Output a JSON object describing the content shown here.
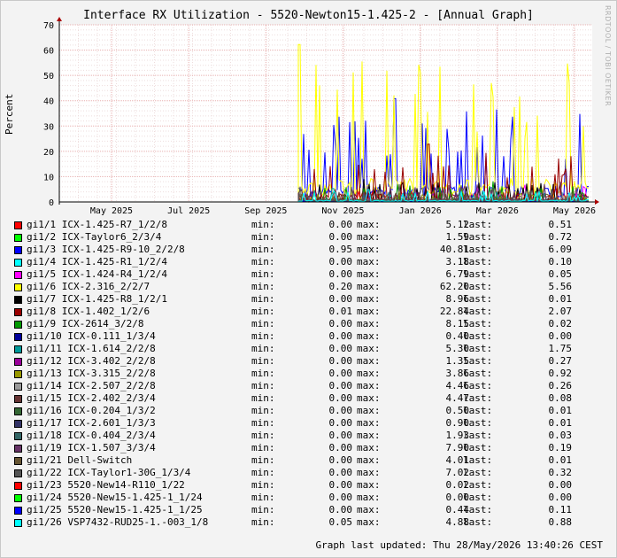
{
  "title": "Interface RX Utilization - 5520-Newton15-1.425-2 - [Annual Graph]",
  "watermark": "RRDTOOL / TOBI OETIKER",
  "updated": "Graph last updated: Thu 28/May/2026 13:40:26 CEST",
  "labels": {
    "min": "min:",
    "max": "max:",
    "last": "last:"
  },
  "colors": {
    "background": "#f3f3f3",
    "canvas": "#ffffff",
    "grid": "#e8b0b0",
    "axis": "#000000",
    "arrow": "#aa0000"
  },
  "chart_data": {
    "type": "line",
    "ylabel": "Percent",
    "ylim": [
      0,
      70
    ],
    "yticks": [
      0,
      10,
      20,
      30,
      40,
      50,
      60,
      70
    ],
    "xticks": [
      "May 2025",
      "Jul 2025",
      "Sep 2025",
      "Nov 2025",
      "Jan 2026",
      "Mar 2026",
      "May 2026"
    ],
    "grid": true,
    "legend_position": "bottom",
    "series": [
      {
        "name": "gi1/1 ICX-1.425-R7_1/2/8",
        "color": "#ff0000",
        "min": "0.00",
        "max": "5.12",
        "last": "0.51"
      },
      {
        "name": "gi1/2 ICX-Taylor6_2/3/4",
        "color": "#00ff00",
        "min": "0.00",
        "max": "1.59",
        "last": "0.72"
      },
      {
        "name": "gi1/3 ICX-1.425-R9-10_2/2/8",
        "color": "#0000ff",
        "min": "0.95",
        "max": "40.81",
        "last": "6.09"
      },
      {
        "name": "gi1/4 ICX-1.425-R1_1/2/4",
        "color": "#00ffff",
        "min": "0.00",
        "max": "3.18",
        "last": "0.10"
      },
      {
        "name": "gi1/5 ICX-1.424-R4_1/2/4",
        "color": "#ff00ff",
        "min": "0.00",
        "max": "6.79",
        "last": "0.05"
      },
      {
        "name": "gi1/6 ICX-2.316_2/2/7",
        "color": "#ffff00",
        "min": "0.20",
        "max": "62.20",
        "last": "5.56"
      },
      {
        "name": "gi1/7 ICX-1.425-R8_1/2/1",
        "color": "#000000",
        "min": "0.00",
        "max": "8.96",
        "last": "0.01"
      },
      {
        "name": "gi1/8 ICX-1.402_1/2/6",
        "color": "#990000",
        "min": "0.01",
        "max": "22.84",
        "last": "2.07"
      },
      {
        "name": "gi1/9 ICX-2614_3/2/8",
        "color": "#009900",
        "min": "0.00",
        "max": "8.15",
        "last": "0.02"
      },
      {
        "name": "gi1/10 ICX-0.111_1/3/4",
        "color": "#000099",
        "min": "0.00",
        "max": "0.40",
        "last": "0.00"
      },
      {
        "name": "gi1/11 ICX-1.614_2/2/8",
        "color": "#009999",
        "min": "0.00",
        "max": "5.30",
        "last": "1.75"
      },
      {
        "name": "gi1/12 ICX-3.402_2/2/8",
        "color": "#990099",
        "min": "0.00",
        "max": "1.35",
        "last": "0.27"
      },
      {
        "name": "gi1/13 ICX-3.315_2/2/8",
        "color": "#999900",
        "min": "0.00",
        "max": "3.86",
        "last": "0.92"
      },
      {
        "name": "gi1/14 ICX-2.507_2/2/8",
        "color": "#999999",
        "min": "0.00",
        "max": "4.46",
        "last": "0.26"
      },
      {
        "name": "gi1/15 ICX-2.402_2/3/4",
        "color": "#663333",
        "min": "0.00",
        "max": "4.47",
        "last": "0.08"
      },
      {
        "name": "gi1/16 ICX-0.204_1/3/2",
        "color": "#336633",
        "min": "0.00",
        "max": "0.50",
        "last": "0.01"
      },
      {
        "name": "gi1/17 ICX-2.601_1/3/3",
        "color": "#333366",
        "min": "0.00",
        "max": "0.90",
        "last": "0.01"
      },
      {
        "name": "gi1/18 ICX-0.404_2/3/4",
        "color": "#336666",
        "min": "0.00",
        "max": "1.93",
        "last": "0.03"
      },
      {
        "name": "gi1/19 ICX-1.507_3/3/4",
        "color": "#663366",
        "min": "0.00",
        "max": "7.90",
        "last": "0.19"
      },
      {
        "name": "gi1/21 Dell-Switch",
        "color": "#665533",
        "min": "0.00",
        "max": "4.01",
        "last": "0.01"
      },
      {
        "name": "gi1/22 ICX-Taylor1-30G_1/3/4",
        "color": "#555555",
        "min": "0.00",
        "max": "7.02",
        "last": "0.32"
      },
      {
        "name": "gi1/23 5520-New14-R110_1/22",
        "color": "#ff0000",
        "min": "0.00",
        "max": "0.02",
        "last": "0.00"
      },
      {
        "name": "gi1/24 5520-New15-1.425-1_1/24",
        "color": "#00ff00",
        "min": "0.00",
        "max": "0.00",
        "last": "0.00"
      },
      {
        "name": "gi1/25 5520-New15-1.425-1_1/25",
        "color": "#0000ff",
        "min": "0.00",
        "max": "0.44",
        "last": "0.11"
      },
      {
        "name": "gi1/26 VSP7432-RUD25-1.-003_1/8",
        "color": "#00ffff",
        "min": "0.05",
        "max": "4.88",
        "last": "0.88"
      }
    ]
  }
}
